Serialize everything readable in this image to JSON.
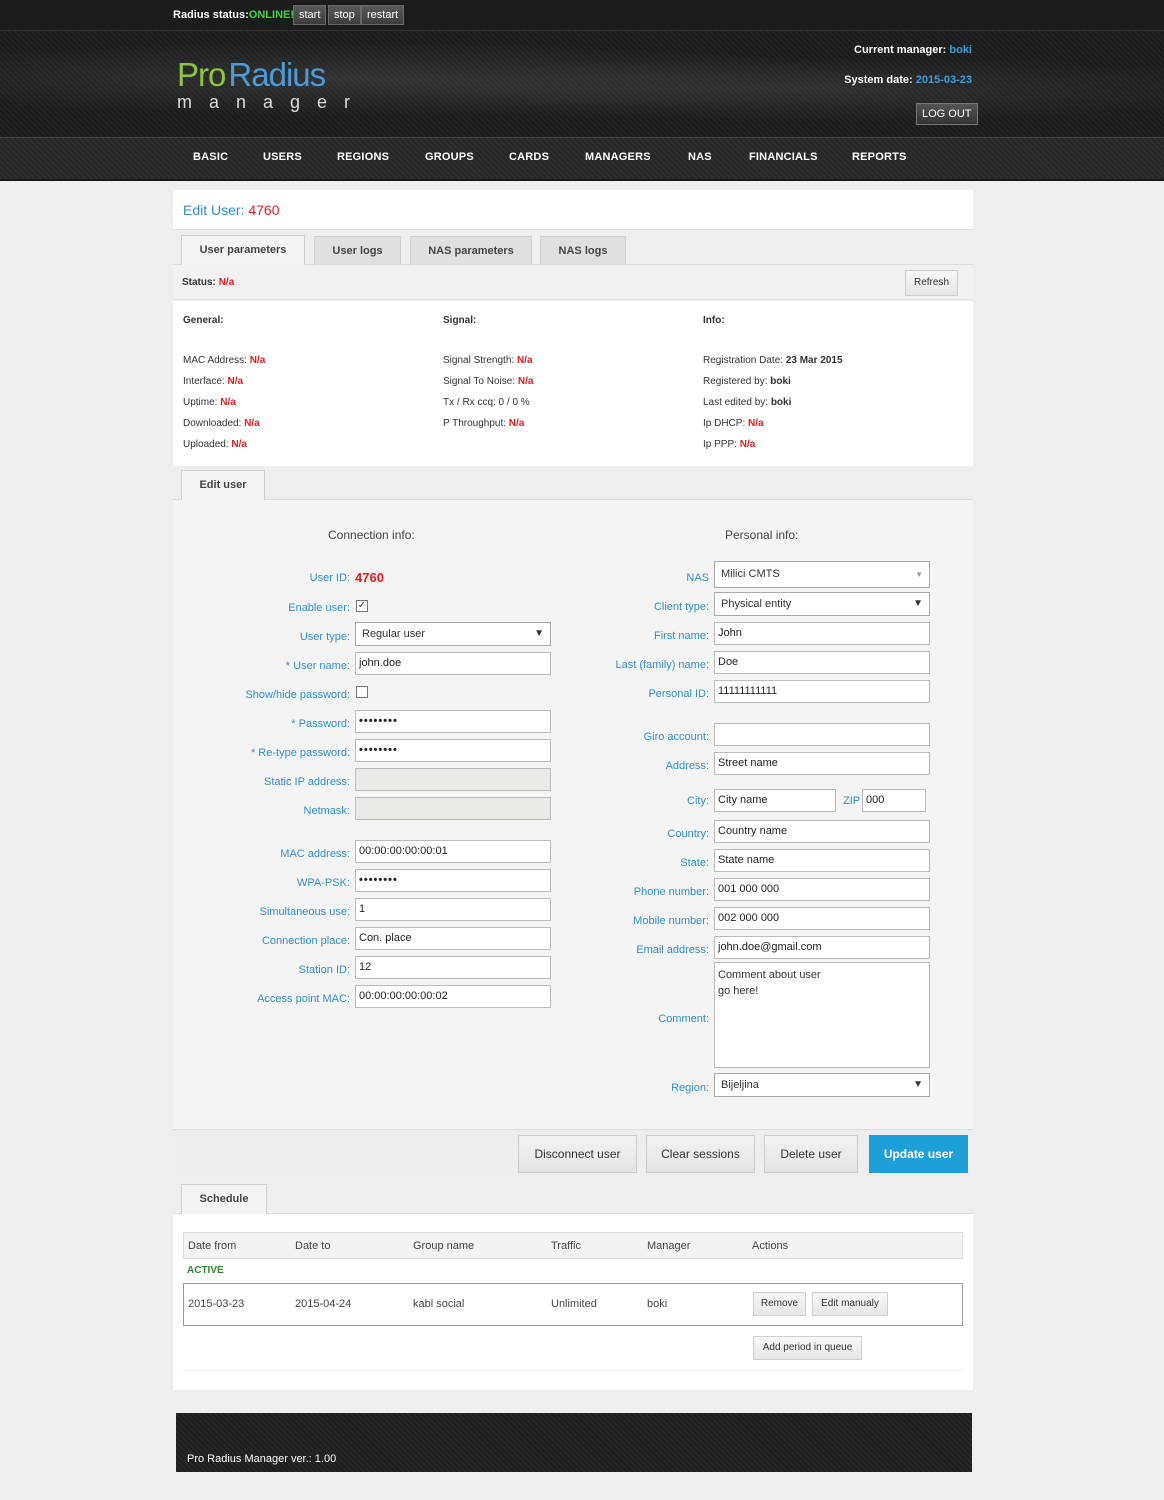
{
  "topbar": {
    "status_label": "Radius status:",
    "status_value": "ONLINE!",
    "buttons": [
      "start",
      "stop",
      "restart"
    ]
  },
  "header": {
    "logo_pro": "Pro",
    "logo_radius": "Radius",
    "logo_manager": "manager",
    "current_manager_label": "Current manager:",
    "current_manager_value": "boki",
    "system_date_label": "System date:",
    "system_date_value": "2015-03-23",
    "logout": "LOG OUT"
  },
  "nav": [
    "BASIC",
    "USERS",
    "REGIONS",
    "GROUPS",
    "CARDS",
    "MANAGERS",
    "NAS",
    "FINANCIALS",
    "REPORTS"
  ],
  "page": {
    "title": "Edit User:",
    "user_id": "4760"
  },
  "tabs": [
    "User parameters",
    "User logs",
    "NAS parameters",
    "NAS logs"
  ],
  "status": {
    "label": "Status:",
    "value": "N/a",
    "refresh": "Refresh"
  },
  "info": {
    "general": {
      "title": "General:",
      "rows": [
        {
          "label": "MAC Address:",
          "value": "N/a"
        },
        {
          "label": "Interface:",
          "value": "N/a"
        },
        {
          "label": "Uptime:",
          "value": "N/a"
        },
        {
          "label": "Downloaded:",
          "value": "N/a"
        },
        {
          "label": "Uploaded:",
          "value": "N/a"
        }
      ]
    },
    "signal": {
      "title": "Signal:",
      "rows": [
        {
          "label": "Signal Strength:",
          "value": "N/a"
        },
        {
          "label": "Signal To Noise:",
          "value": "N/a"
        },
        {
          "label": "Tx / Rx ccq: 0 / 0 %",
          "value": ""
        },
        {
          "label": "P Throughput:",
          "value": "N/a"
        }
      ]
    },
    "info": {
      "title": "Info:",
      "rows": [
        {
          "label": "Registration Date:",
          "value": "23 Mar 2015"
        },
        {
          "label": "Registered by:",
          "value": "boki"
        },
        {
          "label": "Last edited by:",
          "value": "boki"
        },
        {
          "label": "Ip DHCP:",
          "value": "N/a"
        },
        {
          "label": "Ip PPP:",
          "value": "N/a"
        }
      ]
    }
  },
  "edit_tab": "Edit user",
  "connection": {
    "title": "Connection info:",
    "user_id_label": "User ID:",
    "user_id_value": "4760",
    "enable_user_label": "Enable user:",
    "user_type_label": "User type:",
    "user_type_value": "Regular user",
    "username_label": "* User name:",
    "username_value": "john.doe",
    "show_password_label": "Show/hide password:",
    "password_label": "* Password:",
    "password_value": "••••••••",
    "retype_label": "* Re-type password:",
    "retype_value": "••••••••",
    "static_ip_label": "Static IP address:",
    "netmask_label": "Netmask:",
    "mac_label": "MAC address:",
    "mac_value": "00:00:00:00:00:01",
    "wpa_label": "WPA-PSK:",
    "wpa_value": "••••••••",
    "simultaneous_label": "Simultaneous use:",
    "simultaneous_value": "1",
    "place_label": "Connection place:",
    "place_value": "Con. place",
    "station_label": "Station ID:",
    "station_value": "12",
    "ap_mac_label": "Access point MAC:",
    "ap_mac_value": "00:00:00:00:00:02"
  },
  "personal": {
    "title": "Personal info:",
    "nas_label": "NAS",
    "nas_value": "Milici CMTS",
    "client_type_label": "Client type:",
    "client_type_value": "Physical entity",
    "first_name_label": "First name:",
    "first_name_value": "John",
    "last_name_label": "Last (family) name:",
    "last_name_value": "Doe",
    "personal_id_label": "Personal ID:",
    "personal_id_value": "11111111111",
    "giro_label": "Giro account:",
    "giro_value": "",
    "address_label": "Address:",
    "address_value": "Street name",
    "city_label": "City:",
    "city_value": "City name",
    "zip_label": "ZIP",
    "zip_value": "000",
    "country_label": "Country:",
    "country_value": "Country name",
    "state_label": "State:",
    "state_value": "State name",
    "phone_label": "Phone number:",
    "phone_value": "001 000 000",
    "mobile_label": "Mobile number:",
    "mobile_value": "002 000 000",
    "email_label": "Email address:",
    "email_value": "john.doe@gmail.com",
    "comment_label": "Comment:",
    "comment_value": "Comment about user\ngo here!",
    "region_label": "Region:",
    "region_value": "Bijeljina"
  },
  "actions": {
    "disconnect": "Disconnect user",
    "clear": "Clear sessions",
    "delete": "Delete user",
    "update": "Update user"
  },
  "schedule": {
    "tab": "Schedule",
    "columns": [
      "Date from",
      "Date to",
      "Group name",
      "Traffic",
      "Manager",
      "Actions"
    ],
    "active_label": "ACTIVE",
    "row": {
      "date_from": "2015-03-23",
      "date_to": "2015-04-24",
      "group": "kabl social",
      "traffic": "Unlimited",
      "manager": "boki"
    },
    "remove": "Remove",
    "edit_manual": "Edit manualy",
    "add_period": "Add period in queue"
  },
  "footer": {
    "text": "Pro Radius Manager  ver.: 1.00"
  }
}
